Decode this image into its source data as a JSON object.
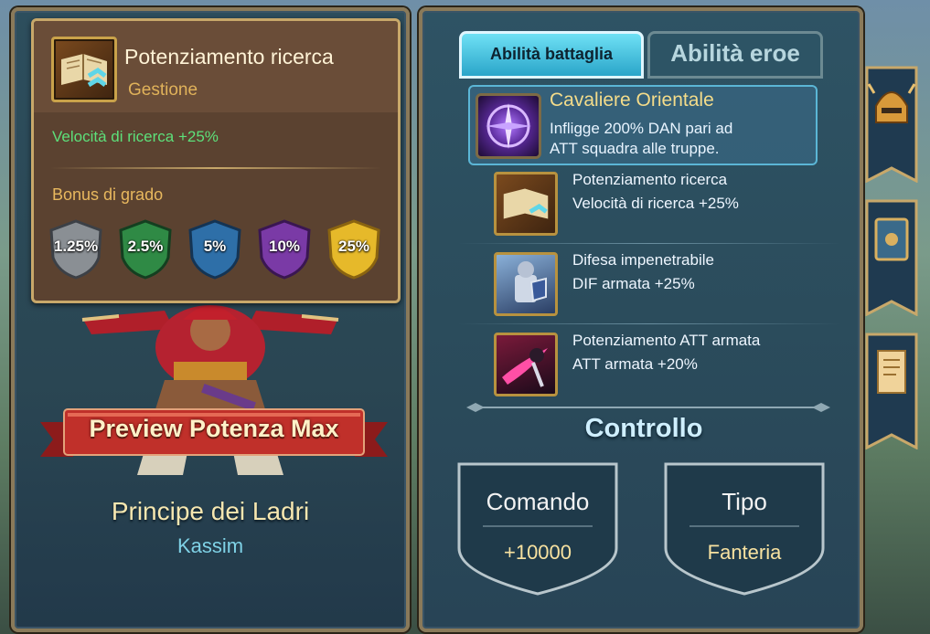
{
  "tooltip": {
    "title": "Potenziamento ricerca",
    "subtitle": "Gestione",
    "effect": "Velocità di ricerca +25%",
    "bonus_header": "Bonus di grado",
    "grade_bonuses": [
      {
        "value": "1.25%",
        "color": "#8a8f94"
      },
      {
        "value": "2.5%",
        "color": "#2f8a45"
      },
      {
        "value": "5%",
        "color": "#2e6fa8"
      },
      {
        "value": "10%",
        "color": "#7a3aa6"
      },
      {
        "value": "25%",
        "color": "#e6b92a"
      }
    ]
  },
  "hero": {
    "preview_button": "Preview Potenza Max",
    "name": "Principe dei Ladri",
    "subname": "Kassim"
  },
  "tabs": [
    {
      "label": "Abilità battaglia",
      "active": true
    },
    {
      "label": "Abilità eroe",
      "active": false
    }
  ],
  "main_skill": {
    "title": "Cavaliere Orientale",
    "desc_line1": "Infligge 200% DAN pari ad",
    "desc_line2": "ATT squadra alle truppe.",
    "icon": "dagger-star-icon"
  },
  "sub_skills": [
    {
      "title": "Potenziamento ricerca",
      "effect": "Velocità di ricerca +25%",
      "icon": "research-book-icon"
    },
    {
      "title": "Difesa impenetrabile",
      "effect": "DIF armata +25%",
      "icon": "armored-knight-icon"
    },
    {
      "title": "Potenziamento ATT armata",
      "effect": "ATT armata +20%",
      "icon": "slash-attack-icon"
    }
  ],
  "section_title": "Controllo",
  "stats": [
    {
      "label": "Comando",
      "value": "+10000"
    },
    {
      "label": "Tipo",
      "value": "Fanteria"
    }
  ],
  "side_tabs": [
    {
      "icon": "helmet-icon"
    },
    {
      "icon": "spellbook-icon"
    },
    {
      "icon": "scroll-icon"
    }
  ]
}
